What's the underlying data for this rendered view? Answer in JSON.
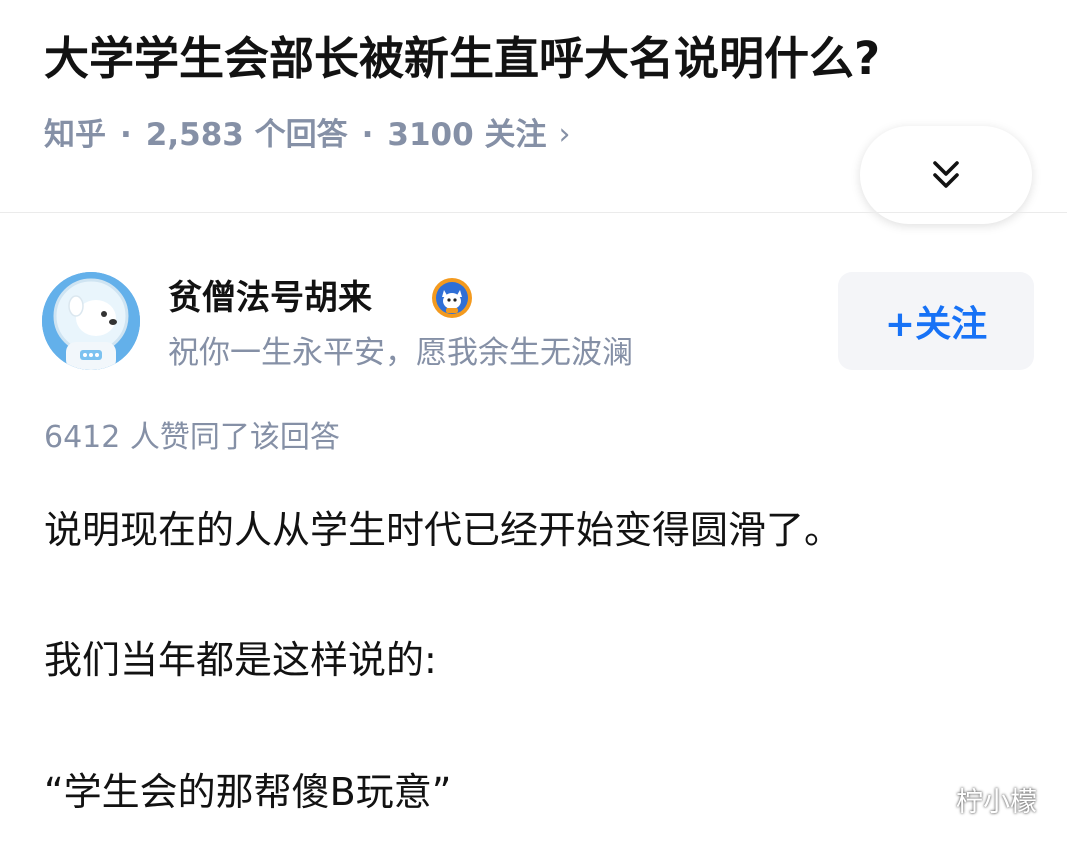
{
  "question": {
    "title": "大学学生会部长被新生直呼大名说明什么?",
    "source": "知乎",
    "answers": "2,583 个回答",
    "follows": "3100 关注",
    "separator": "·",
    "chevron": "›"
  },
  "expand_button": {
    "icon": "double-chevron-down-icon"
  },
  "author": {
    "name": "贫僧法号胡来",
    "bio": "祝你一生永平安，愿我余生无波澜",
    "avatar_icon": "astronaut-bear-avatar",
    "badge_icon": "zhihu-badge-icon"
  },
  "follow_button": {
    "label": "+关注"
  },
  "answer": {
    "votes": "6412 人赞同了该回答",
    "paragraphs": [
      "说明现在的人从学生时代已经开始变得圆滑了。",
      "我们当年都是这样说的:",
      "“学生会的那帮傻B玩意”"
    ]
  },
  "watermark": {
    "label": "柠小檬",
    "icon": "wechat-icon"
  },
  "colors": {
    "text_primary": "#121212",
    "text_secondary": "#8590a6",
    "accent_blue": "#1772f6",
    "button_bg": "#f4f5f8"
  }
}
